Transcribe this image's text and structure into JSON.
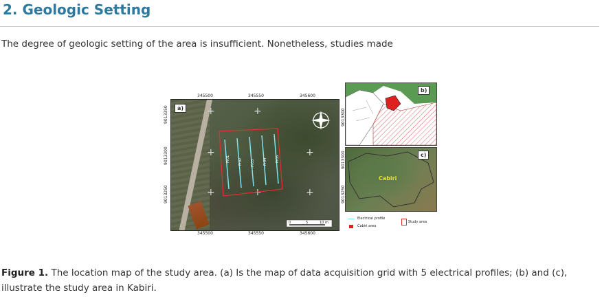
{
  "section": {
    "title": "2. Geologic Setting"
  },
  "body_text": "The degree of geologic setting of the area is insufficient. Nonetheless, studies made",
  "figure": {
    "caption_label": "Figure 1.",
    "caption_text": " The location map of the study area. (a) Is the map of data acquisition grid with 5 electrical profiles; (b) and (c), illustrate the study area in Kabiri.",
    "panel_a": {
      "label": "a)",
      "x_ticks_top": [
        "345500",
        "345550",
        "345600"
      ],
      "x_ticks_bottom": [
        "345500",
        "345550",
        "345600"
      ],
      "y_ticks": [
        "9013350",
        "9013300",
        "9013250"
      ],
      "profiles": [
        "Pr01",
        "Pr02",
        "Pr03",
        "Pr04",
        "Pr05"
      ],
      "scale_labels": [
        "0",
        "5",
        "10 m"
      ]
    },
    "panel_b": {
      "label": "b)",
      "y_tick": "9013300"
    },
    "panel_c": {
      "label": "c)",
      "place_name": "Cabiri",
      "y_ticks": [
        "9013300",
        "9013250"
      ]
    },
    "legend": {
      "electrical_profile": "Electrical profile",
      "cabiri_area": "Cabiri area",
      "study_area": "Study area"
    },
    "colors": {
      "profile_line": "#7fe3f0",
      "study_box": "#e03030",
      "cabiri_fill": "#e02020",
      "heading": "#2e7a9e"
    }
  }
}
